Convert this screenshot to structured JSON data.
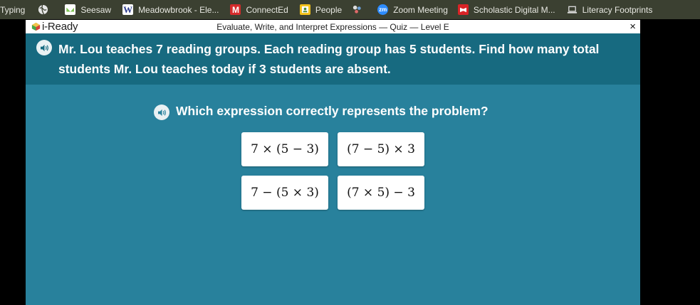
{
  "bookmarks": [
    {
      "label": "Typing",
      "icon": "none"
    },
    {
      "label": "",
      "icon": "globe-icon"
    },
    {
      "label": "Seesaw",
      "icon": "seesaw-icon"
    },
    {
      "label": "Meadowbrook - Ele...",
      "icon": "w-logo-icon"
    },
    {
      "label": "ConnectEd",
      "icon": "m-logo-icon"
    },
    {
      "label": "People",
      "icon": "people-icon"
    },
    {
      "label": "",
      "icon": "puzzle-icon"
    },
    {
      "label": "Zoom Meeting",
      "icon": "zoom-icon"
    },
    {
      "label": "Scholastic Digital M...",
      "icon": "scholastic-icon"
    },
    {
      "label": "Literacy Footprints",
      "icon": "laptop-icon"
    }
  ],
  "window": {
    "brand": "i-Ready",
    "title": "Evaluate, Write, and Interpret Expressions — Quiz — Level E",
    "close": "×"
  },
  "problem": {
    "text": "Mr. Lou teaches 7 reading groups. Each reading group has 5 students. Find how many total students Mr. Lou teaches today if 3 students are absent."
  },
  "question": {
    "text": "Which expression correctly represents the problem?"
  },
  "choices": [
    "7 × (5 − 3)",
    "(7 − 5) × 3",
    "7 − (5 × 3)",
    "(7 × 5) − 3"
  ],
  "colors": {
    "bookmark_bar": "#3b4031",
    "banner": "#176a80",
    "panel": "#28819c"
  }
}
